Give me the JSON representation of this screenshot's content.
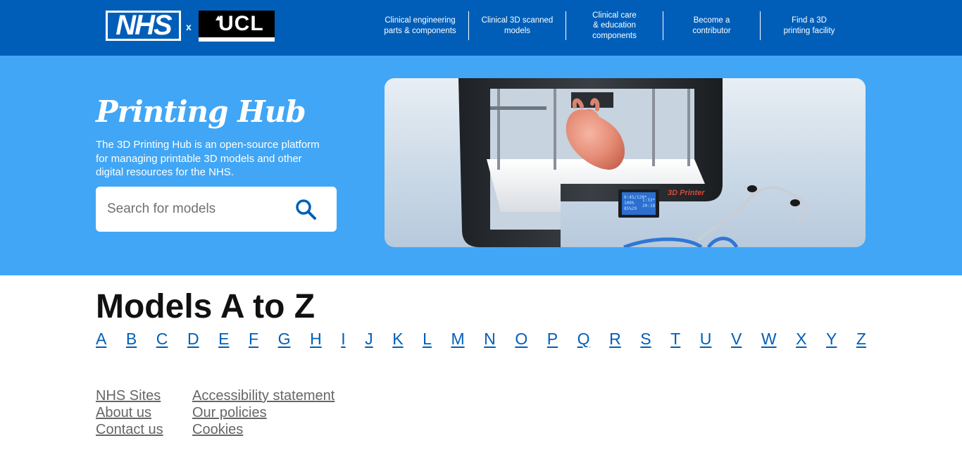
{
  "header": {
    "logo_nhs": "NHS",
    "logo_separator": "x",
    "logo_ucl": "UCL",
    "nav": [
      {
        "label": "Clinical engineering\nparts & components"
      },
      {
        "label": "Clinical 3D scanned\nmodels"
      },
      {
        "label": "Clinical care\n& education\ncomponents"
      },
      {
        "label": "Become a\ncontributor"
      },
      {
        "label": "Find a 3D\nprinting facility"
      }
    ]
  },
  "hero": {
    "title": "Printing Hub",
    "description": "The 3D Printing Hub is an open-source platform for managing printable 3D models and other digital resources for the NHS.",
    "search_placeholder": "Search for models",
    "image": {
      "printer_brand": "3D Printer",
      "display_lines": [
        "0:45/120*",
        "100%",
        "85%29",
        "1:33*",
        "20:18"
      ]
    }
  },
  "models": {
    "title": "Models A to Z",
    "letters": [
      "A",
      "B",
      "C",
      "D",
      "E",
      "F",
      "G",
      "H",
      "I",
      "J",
      "K",
      "L",
      "M",
      "N",
      "O",
      "P",
      "Q",
      "R",
      "S",
      "T",
      "U",
      "V",
      "W",
      "X",
      "Y",
      "Z"
    ]
  },
  "footer": {
    "col1": [
      "NHS Sites",
      "About us",
      "Contact us"
    ],
    "col2": [
      "Accessibility statement",
      "Our policies",
      "Cookies"
    ]
  },
  "colors": {
    "nhs_blue": "#005eb8",
    "hero_blue": "#41a6f5",
    "link_blue": "#005eb8",
    "footer_link": "#666666"
  }
}
